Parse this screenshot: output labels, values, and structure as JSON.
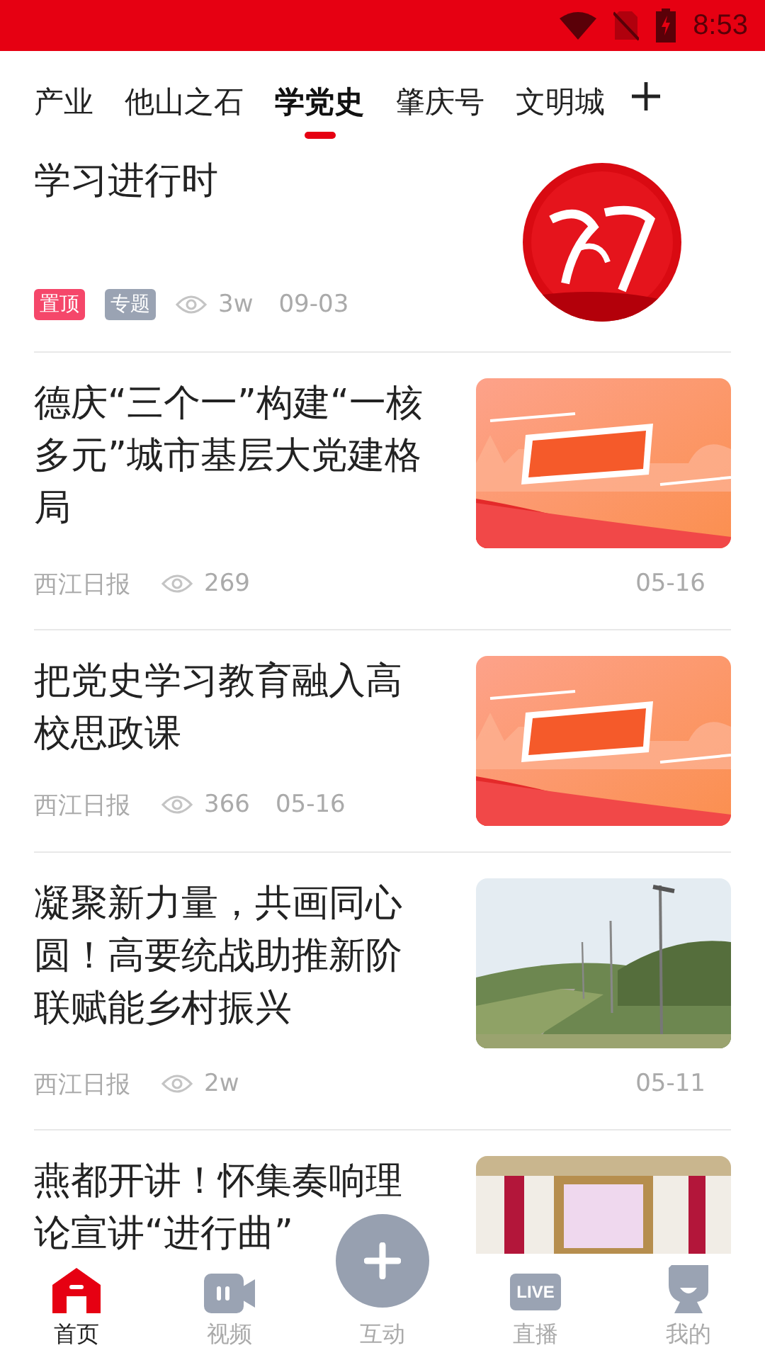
{
  "status_bar": {
    "time": "8:53"
  },
  "tabs": [
    {
      "label": "产业",
      "selected": false
    },
    {
      "label": "他山之石",
      "selected": false
    },
    {
      "label": "学党史",
      "selected": true
    },
    {
      "label": "肇庆号",
      "selected": false
    },
    {
      "label": "文明城",
      "selected": false
    }
  ],
  "articles": [
    {
      "kind": "side",
      "title": "学习进行时",
      "tags": [
        {
          "label": "置顶",
          "color": "#f5476a"
        },
        {
          "label": "专题",
          "color": "#9aa3b3"
        }
      ],
      "views": "3w",
      "date": "09-03",
      "thumbnail": {
        "kind": "seal"
      }
    },
    {
      "kind": "stacked",
      "title": "德庆“三个一”构建“一核多元”城市基层大党建格局",
      "source": "西江日报",
      "views": "269",
      "date": "05-16",
      "thumbnail": {
        "kind": "banner"
      }
    },
    {
      "kind": "side",
      "title": "把党史学习教育融入高校思政课",
      "source": "西江日报",
      "views": "366",
      "date": "05-16",
      "thumbnail": {
        "kind": "banner"
      }
    },
    {
      "kind": "stacked",
      "title": "凝聚新力量，共画同心圆！高要统战助推新阶联赋能乡村振兴",
      "source": "西江日报",
      "views": "2w",
      "date": "05-11",
      "thumbnail": {
        "kind": "street"
      }
    },
    {
      "title": "燕都开讲！怀集奏响理论宣讲“进行曲”",
      "thumbnail": {
        "kind": "hall"
      }
    }
  ],
  "nav": [
    {
      "kind": "home",
      "label": "首页",
      "selected": true
    },
    {
      "kind": "video",
      "label": "视频",
      "selected": false
    },
    {
      "kind": "action",
      "label": "互动",
      "selected": false
    },
    {
      "kind": "live",
      "label": "直播",
      "selected": false,
      "icon_text": "LIVE"
    },
    {
      "kind": "profile",
      "label": "我的",
      "selected": false
    }
  ]
}
